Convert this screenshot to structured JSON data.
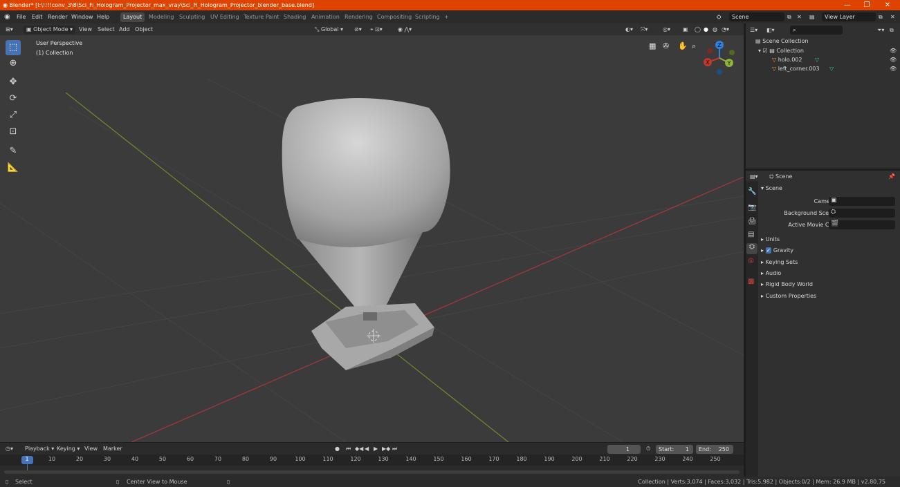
{
  "window": {
    "title": "Blender* [I:\\!!!!conv_3\\8\\Sci_Fi_Hologram_Projector_max_vray\\Sci_Fi_Hologram_Projector_blender_base.blend]",
    "controls": [
      "—",
      "❐",
      "✕"
    ]
  },
  "menubar": {
    "menus": [
      "File",
      "Edit",
      "Render",
      "Window",
      "Help"
    ],
    "workspaces": [
      "Layout",
      "Modeling",
      "Sculpting",
      "UV Editing",
      "Texture Paint",
      "Shading",
      "Animation",
      "Rendering",
      "Compositing",
      "Scripting"
    ],
    "active_workspace": "Layout",
    "add_tab": "+",
    "scene_label": "Scene",
    "view_layer_label": "View Layer"
  },
  "viewport_header": {
    "mode": "Object Mode",
    "menus": [
      "View",
      "Select",
      "Add",
      "Object"
    ],
    "orientation": "Global"
  },
  "viewport": {
    "perspective_label": "User Perspective",
    "collection_label": "(1) Collection",
    "gizmo_axes": [
      "X",
      "Y",
      "Z"
    ],
    "colors": {
      "background": "#3b3b3b",
      "x_axis": "#c0392b",
      "y_axis": "#8db33a",
      "z_axis": "#2f7fe0"
    }
  },
  "outliner": {
    "search_placeholder": "",
    "root": "Scene Collection",
    "items": [
      {
        "label": "Collection",
        "depth": 1
      },
      {
        "label": "holo.002",
        "depth": 2
      },
      {
        "label": "left_corner.003",
        "depth": 2
      }
    ]
  },
  "properties": {
    "header_title": "Scene",
    "section": "Scene",
    "fields": [
      {
        "label": "Camera",
        "value": ""
      },
      {
        "label": "Background Scene",
        "value": ""
      },
      {
        "label": "Active Movie Clip",
        "value": ""
      }
    ],
    "panels": [
      "Units",
      "Gravity",
      "Keying Sets",
      "Audio",
      "Rigid Body World",
      "Custom Properties"
    ],
    "gravity_checked": true
  },
  "timeline": {
    "menus": [
      "Playback",
      "Keying",
      "View",
      "Marker"
    ],
    "current_frame": "1",
    "start_label": "Start:",
    "start": "1",
    "end_label": "End:",
    "end": "250",
    "ticks": [
      "1",
      "10",
      "20",
      "30",
      "40",
      "50",
      "60",
      "70",
      "80",
      "90",
      "100",
      "110",
      "120",
      "130",
      "140",
      "150",
      "160",
      "170",
      "180",
      "190",
      "200",
      "210",
      "220",
      "230",
      "240",
      "250"
    ]
  },
  "statusbar": {
    "select": "Select",
    "center_view": "Center View to Mouse",
    "stats": "Collection | Verts:3,074 | Faces:3,032 | Tris:5,982 | Objects:0/2 | Mem: 26.9 MB | v2.80.75"
  }
}
